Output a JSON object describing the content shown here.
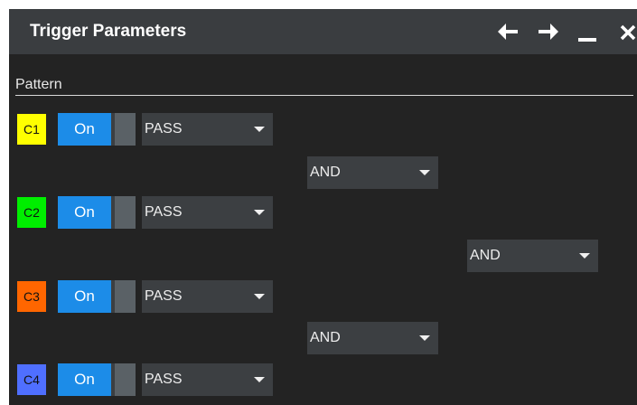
{
  "dialog": {
    "title": "Trigger Parameters",
    "controls": {
      "back_icon": "arrow-left",
      "forward_icon": "arrow-right",
      "minimize_icon": "minimize",
      "close_icon": "close"
    }
  },
  "pattern": {
    "section_label": "Pattern",
    "channels": [
      {
        "label": "C1",
        "color": "#ffff00",
        "state": "On",
        "condition": "PASS"
      },
      {
        "label": "C2",
        "color": "#00ee00",
        "state": "On",
        "condition": "PASS"
      },
      {
        "label": "C3",
        "color": "#ff6600",
        "state": "On",
        "condition": "PASS"
      },
      {
        "label": "C4",
        "color": "#4f6fff",
        "state": "On",
        "condition": "PASS"
      }
    ],
    "logic": {
      "c1_c2": "AND",
      "c3_c4": "AND",
      "final": "AND"
    }
  },
  "colors": {
    "background": "#232323",
    "titlebar": "#3a3d40",
    "toggle_on": "#1c8ce8",
    "combo": "#3c3f42"
  }
}
